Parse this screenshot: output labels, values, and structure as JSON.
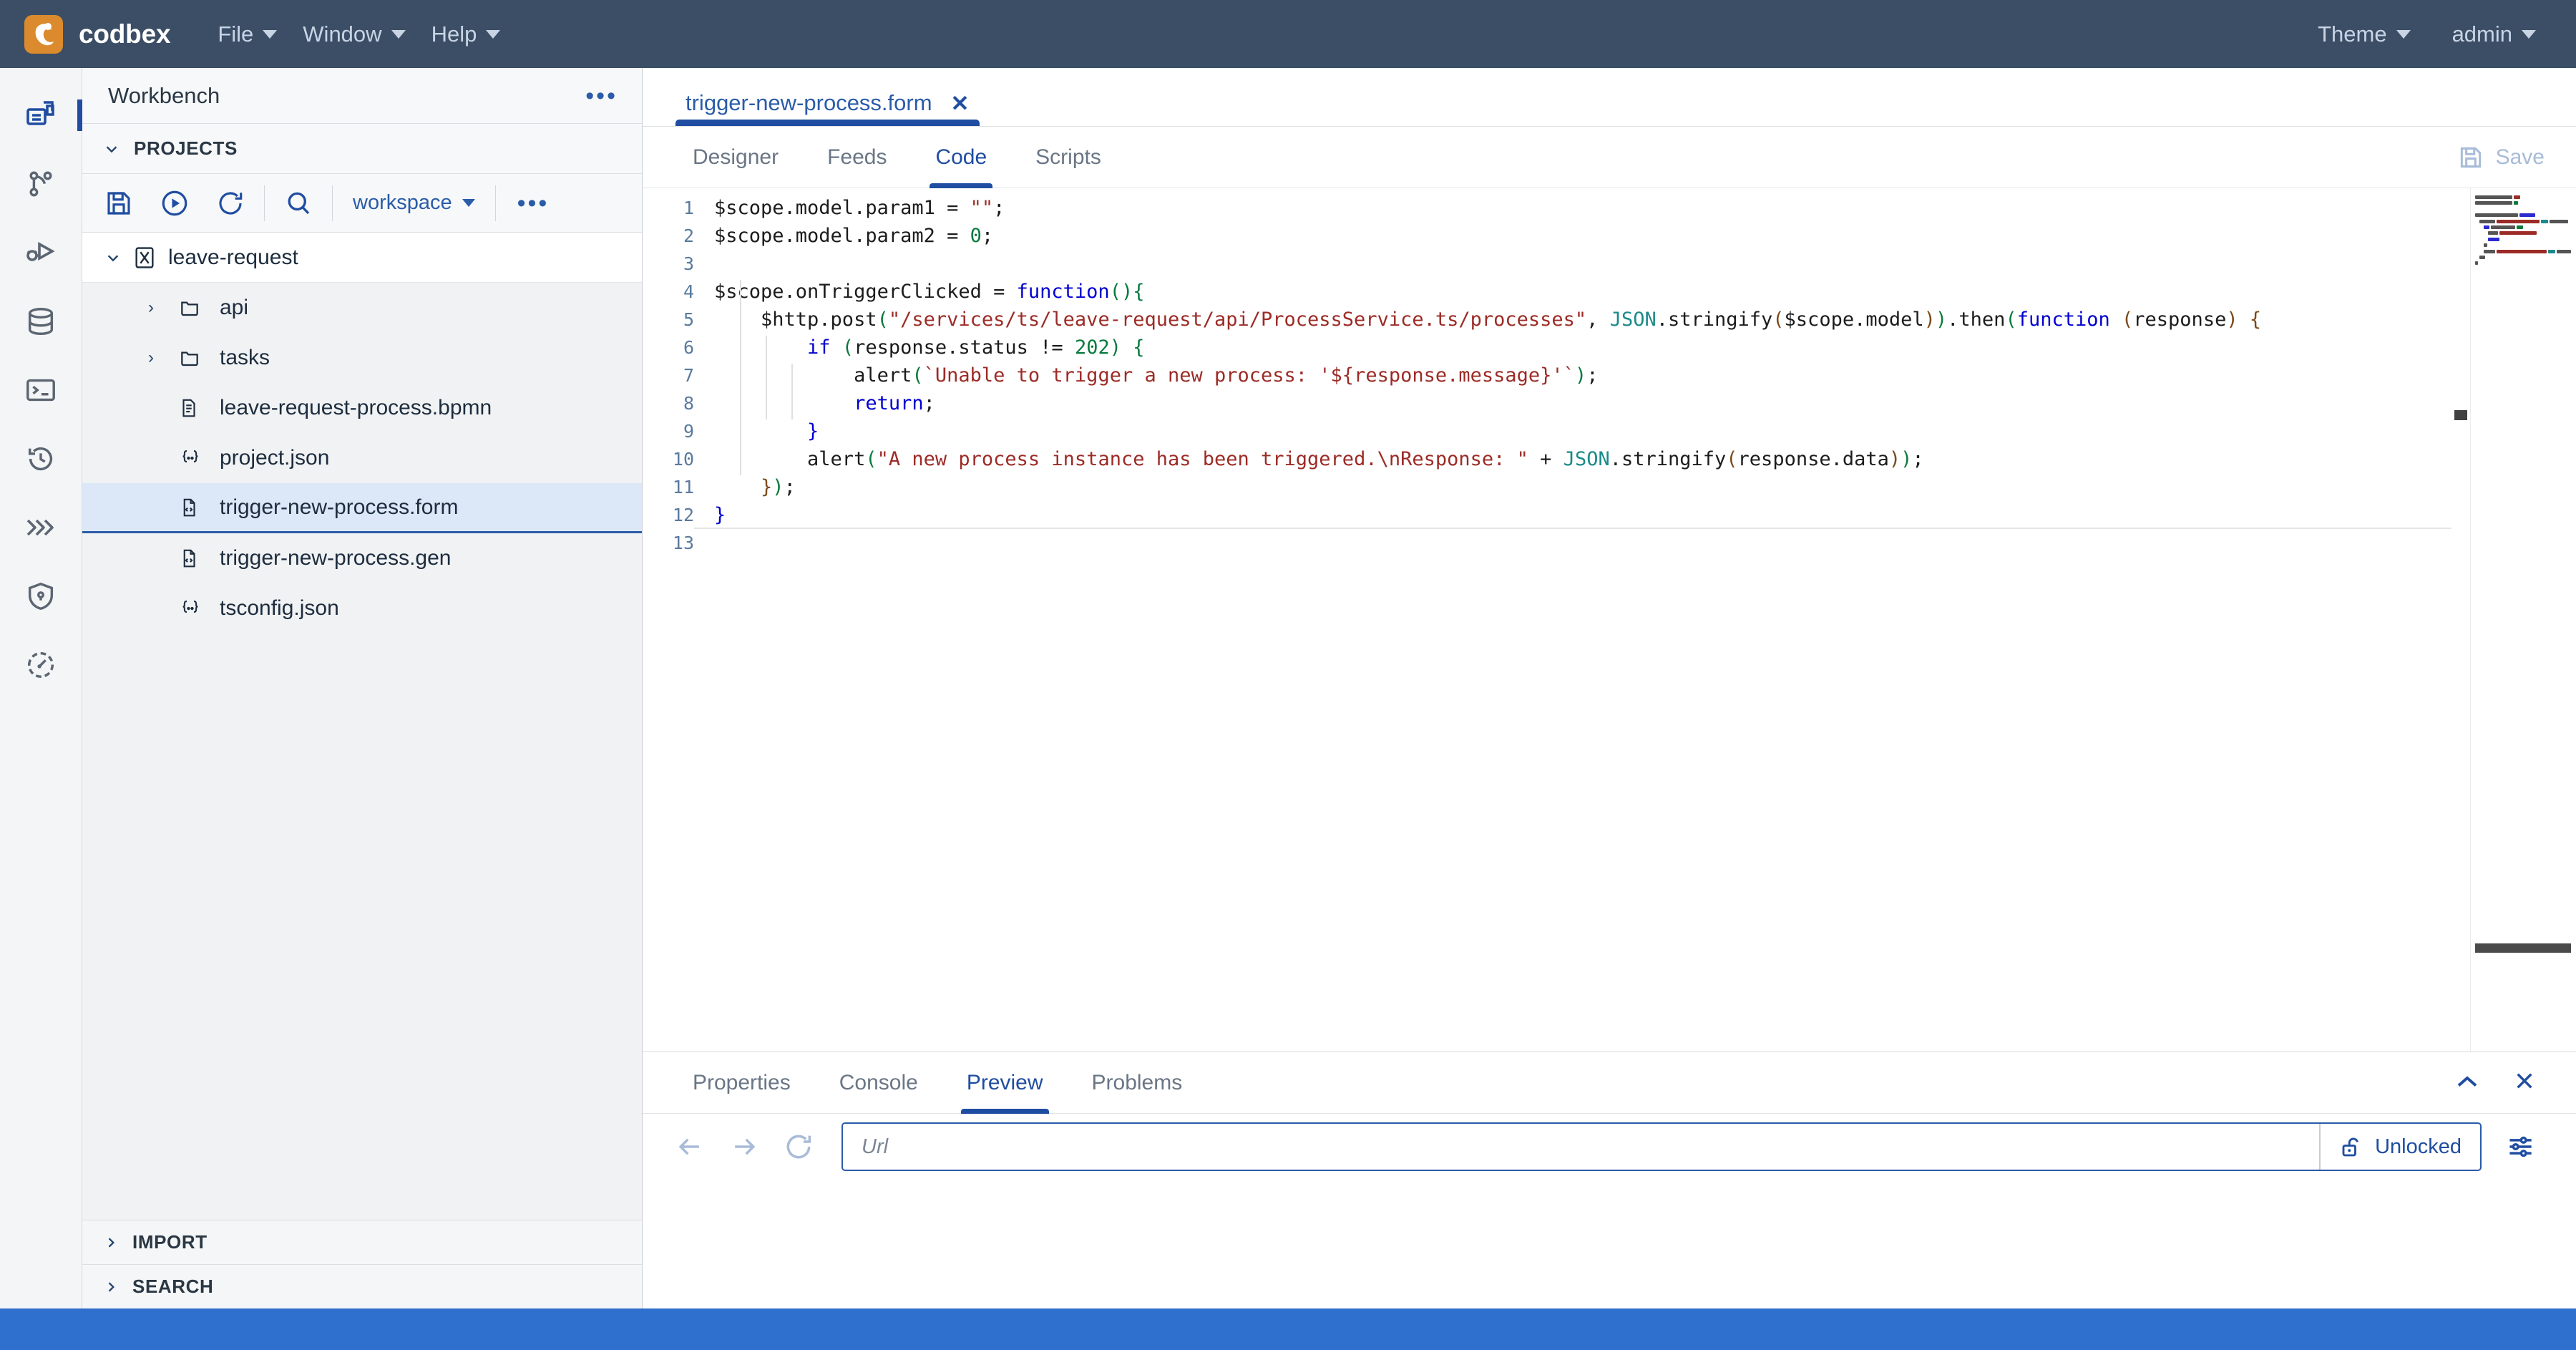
{
  "topbar": {
    "brand": "codbex",
    "menus": [
      {
        "label": "File",
        "icon": "chevron-down-icon"
      },
      {
        "label": "Window",
        "icon": "chevron-down-icon"
      },
      {
        "label": "Help",
        "icon": "chevron-down-icon"
      }
    ],
    "theme_label": "Theme",
    "user_label": "admin",
    "bg_color": "#3b4e66",
    "logo_color": "#db8b2d"
  },
  "activity_bar": {
    "items": [
      {
        "name": "workbench-icon",
        "title": "Workbench",
        "active": true
      },
      {
        "name": "git-branch-icon",
        "title": "Git",
        "active": false
      },
      {
        "name": "debug-icon",
        "title": "Debugger",
        "active": false
      },
      {
        "name": "database-icon",
        "title": "Database",
        "active": false
      },
      {
        "name": "terminal-icon",
        "title": "Terminal",
        "active": false
      },
      {
        "name": "history-icon",
        "title": "History",
        "active": false
      },
      {
        "name": "chevrons-icon",
        "title": "Jobs",
        "active": false
      },
      {
        "name": "shield-lock-icon",
        "title": "Security",
        "active": false
      },
      {
        "name": "gauge-icon",
        "title": "Monitoring",
        "active": false
      }
    ],
    "active_accent": "#1f4da1"
  },
  "sidebar": {
    "header_title": "Workbench",
    "header_more": "•••",
    "projects_section": {
      "label": "PROJECTS",
      "expanded": true,
      "chevron": "chevron-down-icon"
    },
    "toolbar": {
      "save_icon": "save-icon",
      "publish_icon": "publish-play-icon",
      "refresh_icon": "refresh-icon",
      "search_icon": "search-icon",
      "workspace_label": "workspace",
      "workspace_chevron": "chevron-down-icon",
      "more": "•••"
    },
    "tree": {
      "root": {
        "label": "leave-request",
        "icon": "project-icon",
        "expanded": true,
        "chevron": "chevron-down-icon"
      },
      "children": [
        {
          "label": "api",
          "icon": "folder-icon",
          "type": "folder",
          "expanded": false,
          "selected": false
        },
        {
          "label": "tasks",
          "icon": "folder-icon",
          "type": "folder",
          "expanded": false,
          "selected": false
        },
        {
          "label": "leave-request-process.bpmn",
          "icon": "bpmn-file-icon",
          "type": "file",
          "selected": false
        },
        {
          "label": "project.json",
          "icon": "json-file-icon",
          "type": "file",
          "selected": false
        },
        {
          "label": "trigger-new-process.form",
          "icon": "code-file-icon",
          "type": "file",
          "selected": true
        },
        {
          "label": "trigger-new-process.gen",
          "icon": "code-file-icon",
          "type": "file",
          "selected": false
        },
        {
          "label": "tsconfig.json",
          "icon": "json-file-icon",
          "type": "file",
          "selected": false
        }
      ]
    },
    "bottom_sections": [
      {
        "label": "IMPORT",
        "expanded": false,
        "chevron": "chevron-right-icon"
      },
      {
        "label": "SEARCH",
        "expanded": false,
        "chevron": "chevron-right-icon"
      }
    ]
  },
  "editor": {
    "tabs": [
      {
        "label": "trigger-new-process.form",
        "active": true,
        "close_icon": "close-icon",
        "close_label": "✕"
      }
    ],
    "sub_tabs": [
      {
        "label": "Designer",
        "active": false
      },
      {
        "label": "Feeds",
        "active": false
      },
      {
        "label": "Code",
        "active": true
      },
      {
        "label": "Scripts",
        "active": false
      }
    ],
    "save": {
      "label": "Save",
      "icon": "save-icon",
      "disabled": true
    },
    "line_count": 13,
    "line_numbers": [
      "1",
      "2",
      "3",
      "4",
      "5",
      "6",
      "7",
      "8",
      "9",
      "10",
      "11",
      "12",
      "13"
    ],
    "code_lines": [
      "$scope.model.param1 = \"\";",
      "$scope.model.param2 = 0;",
      "",
      "$scope.onTriggerClicked = function(){",
      "    $http.post(\"/services/ts/leave-request/api/ProcessService.ts/processes\", JSON.stringify($scope.model)).then(function (response) {",
      "        if (response.status != 202) {",
      "            alert(`Unable to trigger a new process: '${response.message}'`);",
      "            return;",
      "        }",
      "        alert(\"A new process instance has been triggered.\\nResponse: \" + JSON.stringify(response.data));",
      "    });",
      "}",
      ""
    ],
    "syntax_colors": {
      "keyword": "#0000d0",
      "string": "#9c2b26",
      "number": "#0a7a3e",
      "class": "#1a8a8a",
      "paren_level1": "#0a7a3e",
      "paren_level2": "#7a4a1a",
      "text": "#1c1c1c",
      "line_number": "#5a7a9e"
    }
  },
  "bottom_panel": {
    "tabs": [
      {
        "label": "Properties",
        "active": false
      },
      {
        "label": "Console",
        "active": false
      },
      {
        "label": "Preview",
        "active": true
      },
      {
        "label": "Problems",
        "active": false
      }
    ],
    "controls": [
      {
        "name": "collapse-panel-button",
        "glyph": "⌃"
      },
      {
        "name": "close-panel-button",
        "glyph": "✕"
      }
    ],
    "preview": {
      "back_icon": "arrow-left-icon",
      "forward_icon": "arrow-right-icon",
      "reload_icon": "reload-icon",
      "url_value": "",
      "url_placeholder": "Url",
      "lock_label": "Unlocked",
      "lock_icon": "unlock-icon",
      "settings_icon": "sliders-icon"
    }
  },
  "statusbar": {
    "color": "#2f6fce",
    "text": ""
  }
}
